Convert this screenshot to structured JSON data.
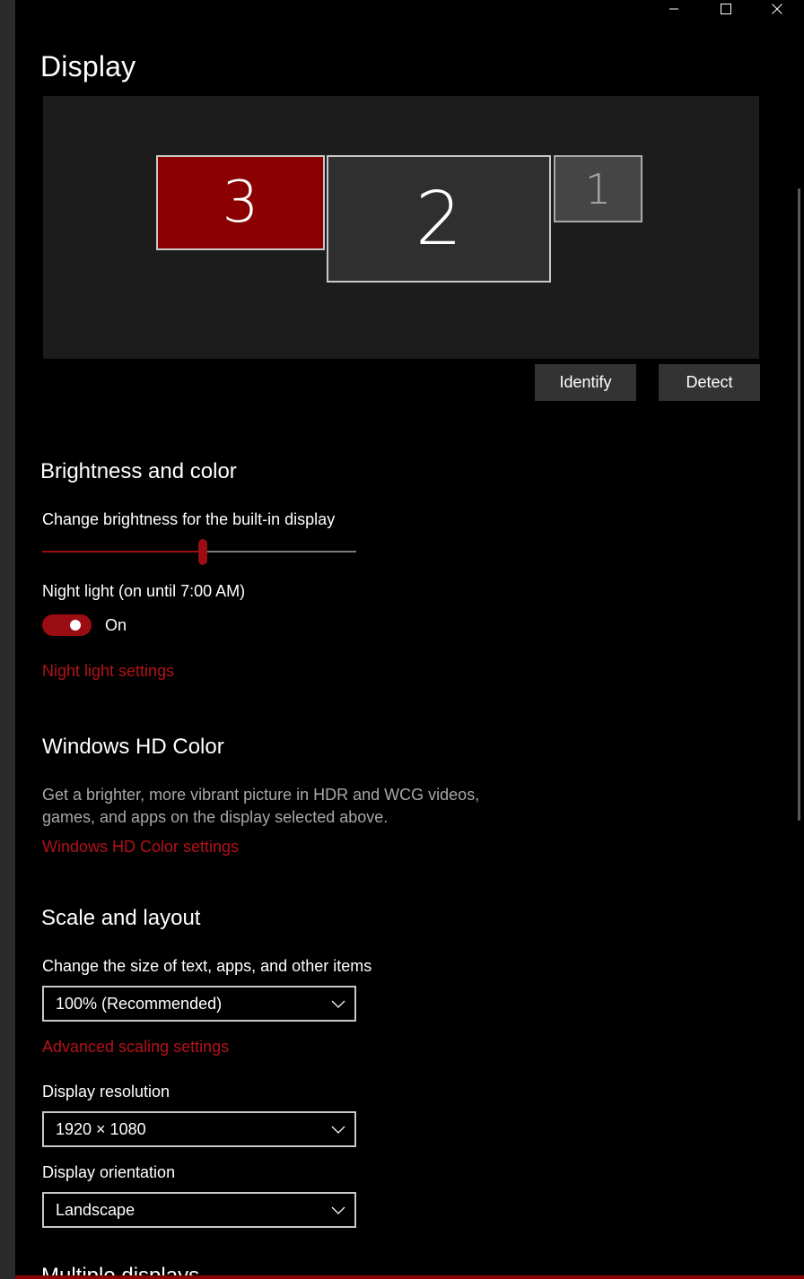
{
  "window": {
    "minimize_glyph": "—",
    "maximize_glyph": "□",
    "close_glyph": "✕"
  },
  "page": {
    "title": "Display"
  },
  "monitors": [
    {
      "number": "3",
      "selected": true
    },
    {
      "number": "2",
      "selected": false
    },
    {
      "number": "1",
      "selected": false
    }
  ],
  "actions": {
    "identify": "Identify",
    "detect": "Detect"
  },
  "brightness": {
    "section_title": "Brightness and color",
    "slider_label": "Change brightness for the built-in display",
    "brightness_level": 0.51,
    "night_light_label": "Night light (on until 7:00 AM)",
    "night_light_state": "On",
    "night_light_link": "Night light settings"
  },
  "hd_color": {
    "section_title": "Windows HD Color",
    "description_line1": "Get a brighter, more vibrant picture in HDR and WCG videos,",
    "description_line2": "games, and apps on the display selected above.",
    "link": "Windows HD Color settings"
  },
  "scale_layout": {
    "section_title": "Scale and layout",
    "scale_label": "Change the size of text, apps, and other items",
    "scale_value": "100% (Recommended)",
    "advanced_link": "Advanced scaling settings",
    "resolution_label": "Display resolution",
    "resolution_value": "1920 × 1080",
    "orientation_label": "Display orientation",
    "orientation_value": "Landscape"
  },
  "next_section": {
    "section_title": "Multiple displays"
  },
  "colors": {
    "accent": "#9a0e13",
    "link": "#b3121a",
    "selected_monitor": "#8b0000"
  }
}
